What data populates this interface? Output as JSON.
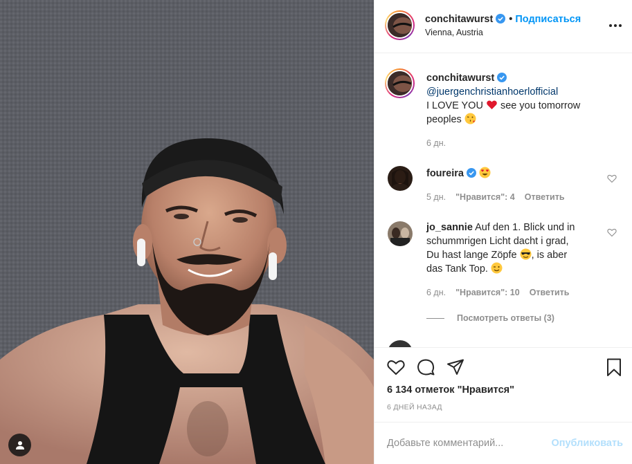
{
  "post": {
    "author": "conchitawurst",
    "follow_label": "Подписаться",
    "dot": "•",
    "location": "Vienna, Austria",
    "more_icon": "more-horizontal-icon",
    "tag_icon": "user-tag-icon"
  },
  "caption": {
    "author": "conchitawurst",
    "mention": "@juergenchristianhoerlofficial",
    "line1_a": "I LOVE YOU",
    "line1_b": " see you tomorrow",
    "line2": "peoples",
    "time": "6 дн."
  },
  "comments": [
    {
      "author": "foureira",
      "time": "5 дн.",
      "likes_label": "\"Нравится\": 4",
      "reply_label": "Ответить"
    },
    {
      "author": "jo_sannie",
      "line1": "Auf den 1. Blick und in",
      "line2": "schummrigen Licht dacht i grad,",
      "line3": "Du hast lange Zöpfe",
      "line3b": ", is aber",
      "line4": "das Tank Top.",
      "time": "6 дн.",
      "likes_label": "\"Нравится\": 10",
      "reply_label": "Ответить"
    }
  ],
  "view_replies": "Посмотреть ответы (3)",
  "actions": {
    "like_icon": "heart-icon",
    "comment_icon": "comment-icon",
    "share_icon": "paper-plane-icon",
    "save_icon": "bookmark-icon"
  },
  "likes_count": "6 134 отметок \"Нравится\"",
  "post_date": "6 ДНЕЙ НАЗАД",
  "comment_input": {
    "placeholder": "Добавьте комментарий...",
    "publish_label": "Опубликовать"
  },
  "colors": {
    "accent": "#0095f6",
    "mention": "#00376b",
    "muted": "#8e8e8e",
    "publish_disabled": "#b2dffc"
  }
}
